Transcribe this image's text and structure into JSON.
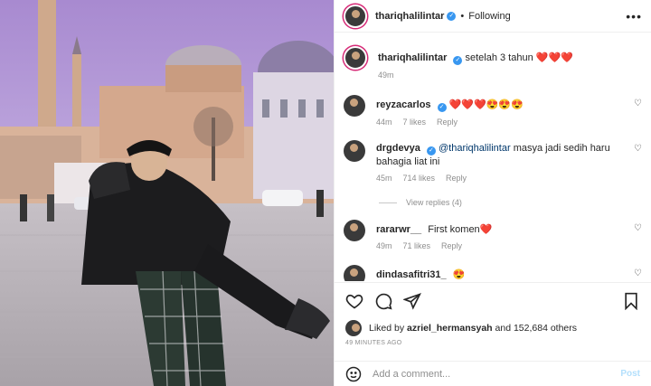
{
  "post": {
    "author": "thariqhalilintar",
    "follow_status": "Following",
    "more_icon": "more-horizontal-icon"
  },
  "caption": {
    "author": "thariqhalilintar",
    "text": "setelah 3 tahun",
    "emoji": "❤️❤️❤️",
    "time": "49m"
  },
  "comments": [
    {
      "user": "reyzacarlos",
      "text": "❤️❤️❤️😍😍😍",
      "mention": "",
      "time": "44m",
      "likes": "7 likes",
      "reply": "Reply"
    },
    {
      "user": "drgdevya",
      "mention": "@thariqhalilintar",
      "text": "masya jadi sedih haru bahagia liat ini",
      "time": "45m",
      "likes": "714 likes",
      "reply": "Reply"
    },
    {
      "user": "rararwr__",
      "text": "First komen❤️",
      "mention": "",
      "time": "49m",
      "likes": "71 likes",
      "reply": "Reply"
    },
    {
      "user": "dindasafitri31_",
      "text": "😍",
      "mention": "",
      "time": "",
      "likes": "",
      "reply": ""
    }
  ],
  "view_replies": "View replies (4)",
  "likes": {
    "prefix": "Liked by",
    "user": "azriel_hermansyah",
    "suffix": "and 152,684 others"
  },
  "time_ago": "49 MINUTES AGO",
  "add_comment": {
    "placeholder": "Add a comment...",
    "post_label": "Post"
  },
  "colors": {
    "accent": "#0095f6",
    "verified": "#3897f0",
    "heart": "#ed4956",
    "muted": "#8e8e8e"
  }
}
